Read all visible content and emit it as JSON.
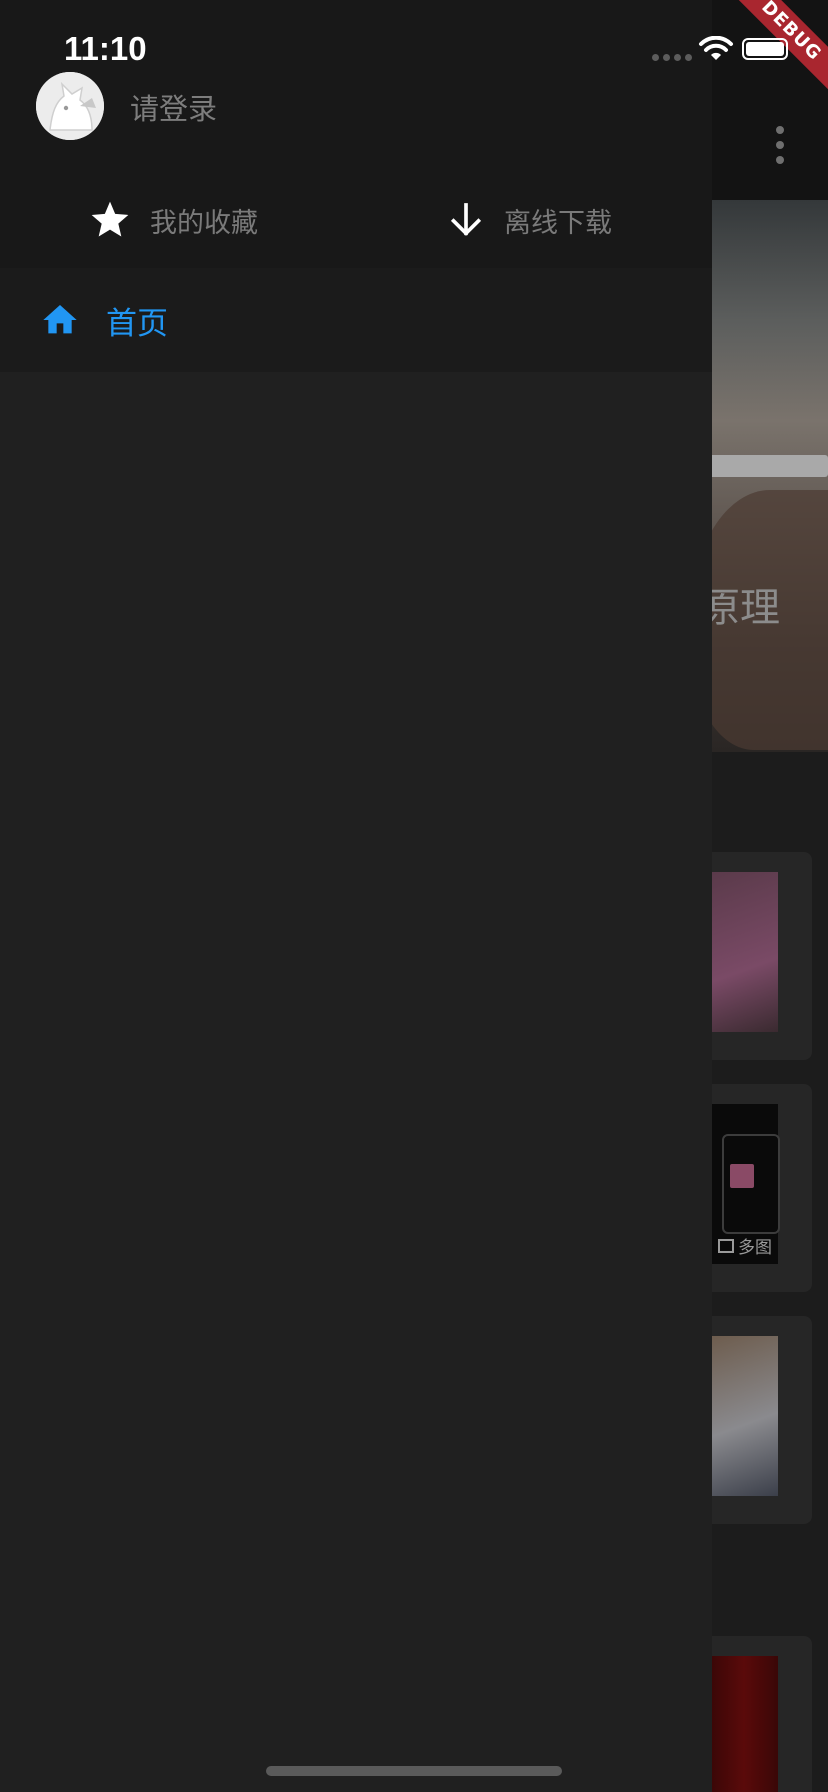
{
  "status_bar": {
    "time": "11:10",
    "icons": [
      "signal-icon",
      "wifi-icon",
      "battery-icon"
    ]
  },
  "debug_banner": "DEBUG",
  "drawer": {
    "login_prompt": "请登录",
    "avatar_icon": "avatar-dog-icon",
    "actions": [
      {
        "label": "我的收藏",
        "icon": "star-icon"
      },
      {
        "label": "离线下载",
        "icon": "download-icon"
      }
    ],
    "menu": [
      {
        "label": "首页",
        "icon": "home-icon",
        "selected": true,
        "color": "#2196f3"
      }
    ]
  },
  "background_page": {
    "hero_title_fragment": "原理",
    "multi_image_badge": "多图",
    "overflow_icon": "more-vert-icon"
  },
  "colors": {
    "accent": "#2196f3",
    "drawer_bg": "#202020",
    "header_bg": "#181818",
    "debug_red": "#a9262f"
  }
}
